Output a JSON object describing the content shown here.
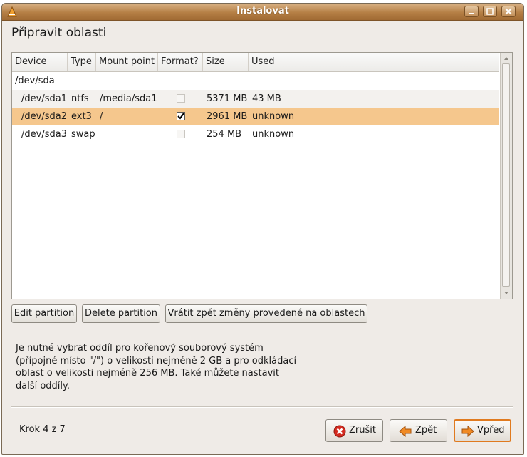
{
  "window": {
    "title": "Instalovat"
  },
  "page": {
    "heading": "Připravit oblasti"
  },
  "table": {
    "columns": [
      "Device",
      "Type",
      "Mount point",
      "Format?",
      "Size",
      "Used"
    ],
    "rows": [
      {
        "device": "/dev/sda",
        "type": "",
        "mount": "",
        "format": null,
        "size": "",
        "used": ""
      },
      {
        "device": "/dev/sda1",
        "type": "ntfs",
        "mount": "/media/sda1",
        "format": false,
        "size": "5371 MB",
        "used": "43 MB"
      },
      {
        "device": "/dev/sda2",
        "type": "ext3",
        "mount": "/",
        "format": true,
        "size": "2961 MB",
        "used": "unknown",
        "selected": true
      },
      {
        "device": "/dev/sda3",
        "type": "swap",
        "mount": "",
        "format": false,
        "size": "254 MB",
        "used": "unknown"
      }
    ]
  },
  "actions": {
    "edit": "Edit partition",
    "delete": "Delete partition",
    "revert": "Vrátit zpět změny provedené na oblastech"
  },
  "info_lines": [
    "Je nutné vybrat oddíl pro kořenový souborový systém",
    "(přípojné místo \"/\") o velikosti nejméně 2 GB a pro odkládací",
    "oblast o velikosti nejméně 256 MB. Také můžete nastavit",
    "další oddíly."
  ],
  "footer": {
    "step": "Krok 4 z 7",
    "cancel": "Zrušit",
    "back": "Zpět",
    "forward": "Vpřed"
  },
  "colors": {
    "titlebar": "#b57f45",
    "selection": "#f5c78d",
    "default_button_border": "#e07a1f"
  },
  "icons": [
    "app-icon",
    "minimize-icon",
    "maximize-icon",
    "close-icon",
    "cancel-icon",
    "back-arrow-icon",
    "forward-arrow-icon",
    "checkmark-icon"
  ]
}
